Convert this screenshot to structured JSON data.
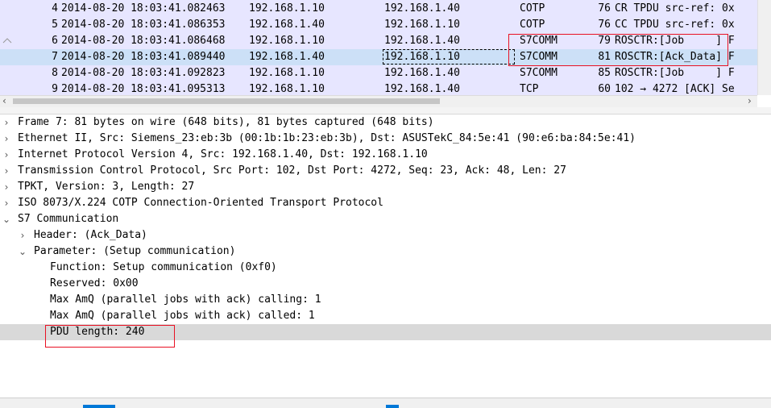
{
  "packets": [
    {
      "no": "4",
      "time": "2014-08-20 18:03:41.082463",
      "src": "192.168.1.10",
      "dst": "192.168.1.40",
      "proto": "COTP",
      "len": "76",
      "info": "CR TPDU src-ref: 0x"
    },
    {
      "no": "5",
      "time": "2014-08-20 18:03:41.086353",
      "src": "192.168.1.40",
      "dst": "192.168.1.10",
      "proto": "COTP",
      "len": "76",
      "info": "CC TPDU src-ref: 0x"
    },
    {
      "no": "6",
      "time": "2014-08-20 18:03:41.086468",
      "src": "192.168.1.10",
      "dst": "192.168.1.40",
      "proto": "S7COMM",
      "len": "79",
      "info": "ROSCTR:[Job     ] F"
    },
    {
      "no": "7",
      "time": "2014-08-20 18:03:41.089440",
      "src": "192.168.1.40",
      "dst": "192.168.1.10",
      "proto": "S7COMM",
      "len": "81",
      "info": "ROSCTR:[Ack_Data] F"
    },
    {
      "no": "8",
      "time": "2014-08-20 18:03:41.092823",
      "src": "192.168.1.10",
      "dst": "192.168.1.40",
      "proto": "S7COMM",
      "len": "85",
      "info": "ROSCTR:[Job     ] F"
    },
    {
      "no": "9",
      "time": "2014-08-20 18:03:41.095313",
      "src": "192.168.1.10",
      "dst": "192.168.1.40",
      "proto": "TCP",
      "len": "60",
      "info": "102 → 4272 [ACK] Se"
    }
  ],
  "details": [
    {
      "caret": "›",
      "text": "Frame 7: 81 bytes on wire (648 bits), 81 bytes captured (648 bits)"
    },
    {
      "caret": "›",
      "text": "Ethernet II, Src: Siemens_23:eb:3b (00:1b:1b:23:eb:3b), Dst: ASUSTekC_84:5e:41 (90:e6:ba:84:5e:41)"
    },
    {
      "caret": "›",
      "text": "Internet Protocol Version 4, Src: 192.168.1.40, Dst: 192.168.1.10"
    },
    {
      "caret": "›",
      "text": "Transmission Control Protocol, Src Port: 102, Dst Port: 4272, Seq: 23, Ack: 48, Len: 27"
    },
    {
      "caret": "›",
      "text": "TPKT, Version: 3, Length: 27"
    },
    {
      "caret": "›",
      "text": "ISO 8073/X.224 COTP Connection-Oriented Transport Protocol"
    },
    {
      "caret": "⌄",
      "text": "S7 Communication"
    },
    {
      "caret": "›",
      "text": "Header: (Ack_Data)"
    },
    {
      "caret": "⌄",
      "text": "Parameter: (Setup communication)"
    },
    {
      "caret": "",
      "text": "Function: Setup communication (0xf0)"
    },
    {
      "caret": "",
      "text": "Reserved: 0x00"
    },
    {
      "caret": "",
      "text": "Max AmQ (parallel jobs with ack) calling: 1"
    },
    {
      "caret": "",
      "text": "Max AmQ (parallel jobs with ack) called: 1"
    },
    {
      "caret": "",
      "text": "PDU length: 240"
    }
  ],
  "icons": {
    "hscroll_left": "chevron-left-icon",
    "hscroll_right": "chevron-right-icon",
    "tree_collapsed": "chevron-right-icon",
    "tree_expanded": "chevron-down-icon"
  },
  "colors": {
    "packet_list_bg": "#e7e6ff",
    "selected_row": "#cce0f7",
    "highlight_row": "#d9d9d9",
    "annotation": "#e81123"
  }
}
